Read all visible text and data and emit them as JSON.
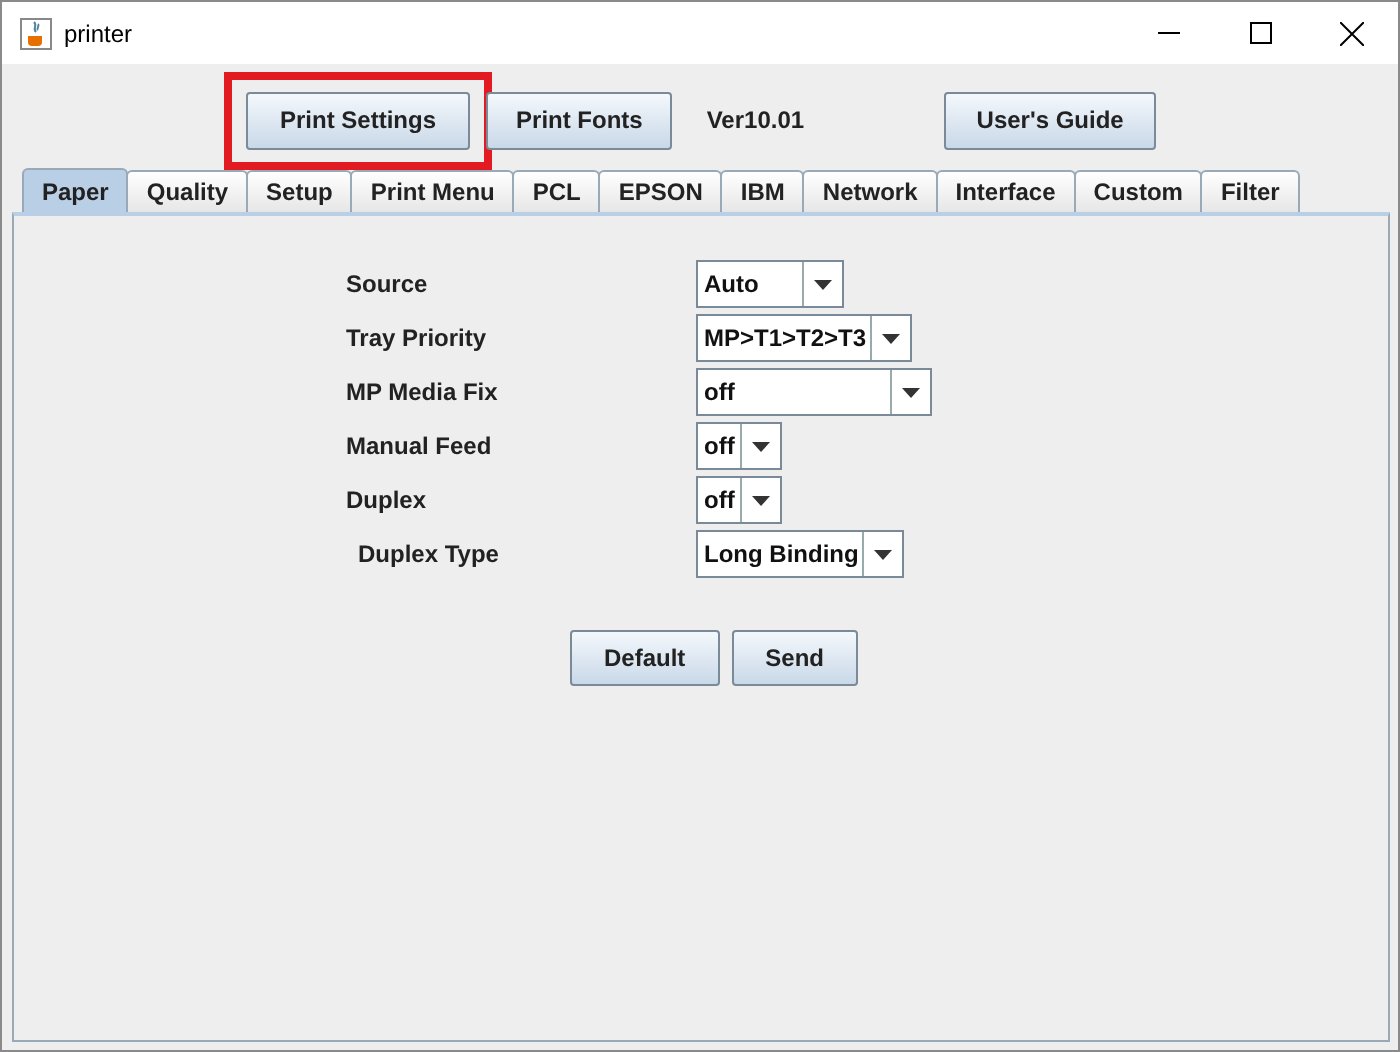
{
  "window": {
    "title": "printer"
  },
  "toolbar": {
    "buttons": [
      {
        "label": "Print Settings",
        "highlighted": true
      },
      {
        "label": "Print Fonts",
        "highlighted": false
      }
    ],
    "version": "Ver10.01",
    "guide_button": "User's Guide"
  },
  "tabs": [
    {
      "label": "Paper",
      "selected": true
    },
    {
      "label": "Quality",
      "selected": false
    },
    {
      "label": "Setup",
      "selected": false
    },
    {
      "label": "Print Menu",
      "selected": false
    },
    {
      "label": "PCL",
      "selected": false
    },
    {
      "label": "EPSON",
      "selected": false
    },
    {
      "label": "IBM",
      "selected": false
    },
    {
      "label": "Network",
      "selected": false
    },
    {
      "label": "Interface",
      "selected": false
    },
    {
      "label": "Custom",
      "selected": false
    },
    {
      "label": "Filter",
      "selected": false
    }
  ],
  "settings": [
    {
      "label": "Source",
      "value": "Auto"
    },
    {
      "label": "Tray Priority",
      "value": "MP>T1>T2>T3"
    },
    {
      "label": "MP Media Fix",
      "value": "off"
    },
    {
      "label": "Manual Feed",
      "value": "off"
    },
    {
      "label": "Duplex",
      "value": "off"
    },
    {
      "label": "Duplex Type",
      "value": "Long Binding"
    }
  ],
  "actions": [
    "Default",
    "Send"
  ]
}
